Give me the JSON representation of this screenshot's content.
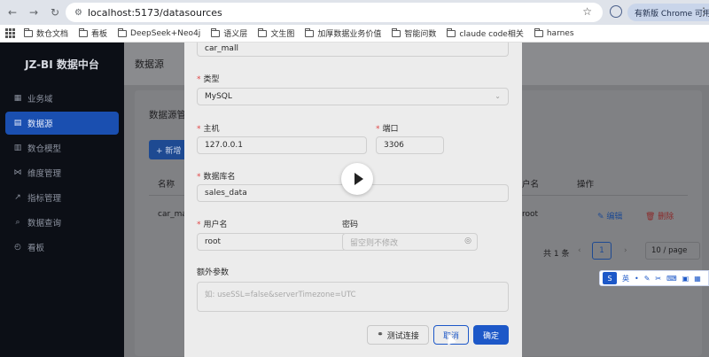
{
  "browser": {
    "url": "localhost:5173/datasources",
    "update_label": "有新版 Chrome 可用",
    "bookmarks": [
      "数仓文档",
      "看板",
      "DeepSeek+Neo4j",
      "语义层",
      "文生图",
      "加厚数据业务价值",
      "智能问数",
      "claude code相关",
      "harnes"
    ]
  },
  "sidebar": {
    "logo": "JZ-BI 数据中台",
    "items": [
      {
        "label": "业务域",
        "icon": "grid-icon"
      },
      {
        "label": "数据源",
        "icon": "database-icon"
      },
      {
        "label": "数仓模型",
        "icon": "layers-icon"
      },
      {
        "label": "维度管理",
        "icon": "share-icon"
      },
      {
        "label": "指标管理",
        "icon": "chart-icon"
      },
      {
        "label": "数据查询",
        "icon": "search-icon"
      },
      {
        "label": "看板",
        "icon": "dashboard-icon"
      }
    ]
  },
  "page": {
    "header_title": "数据源",
    "card_title": "数据源管",
    "new_button": "+ 新增",
    "columns": {
      "name": "名称",
      "owner": "户名",
      "actions": "操作"
    },
    "row": {
      "name": "car_mal",
      "owner": "root",
      "edit": "编辑",
      "delete": "删除"
    },
    "pagination": {
      "total": "共 1 条",
      "page": "1",
      "page_size": "10 / page"
    }
  },
  "modal": {
    "name_value": "car_mall",
    "type_label": "类型",
    "type_value": "MySQL",
    "host_label": "主机",
    "host_value": "127.0.0.1",
    "port_label": "端口",
    "port_value": "3306",
    "db_label": "数据库名",
    "db_value": "sales_data",
    "user_label": "用户名",
    "user_value": "root",
    "pwd_label": "密码",
    "pwd_placeholder": "留空则不修改",
    "extra_label": "额外参数",
    "extra_placeholder": "如: useSSL=false&serverTimezone=UTC",
    "test_button": "测试连接",
    "cancel_button": "取消",
    "ok_button": "确定"
  },
  "ime": {
    "lang": "英"
  }
}
